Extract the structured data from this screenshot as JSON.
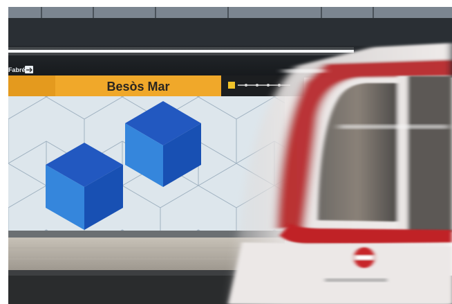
{
  "station": {
    "name": "Besòs Mar",
    "exit_label": "Fabré",
    "sign_color": "#f0a82a",
    "wall_color": "#dde6ec",
    "cube_color": "#1f63c9"
  },
  "train": {
    "body_color": "#e7e3e2",
    "stripe_color": "#b51f22"
  }
}
